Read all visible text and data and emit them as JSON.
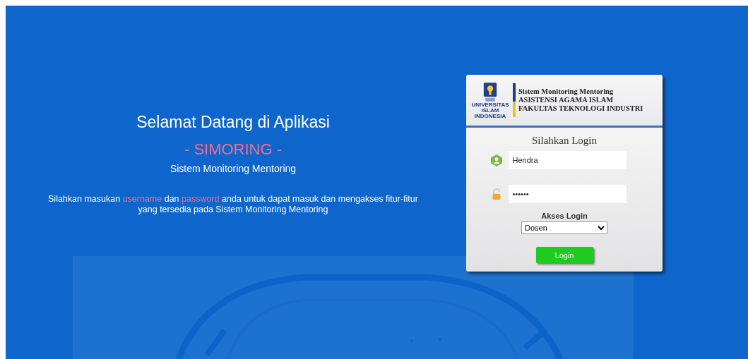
{
  "welcome": {
    "title": "Selamat Datang di Aplikasi",
    "app_name": "- SIMORING -",
    "subtitle": "Sistem Monitoring Mentoring",
    "message": [
      {
        "text": "Silahkan masukan ",
        "highlight": false
      },
      {
        "text": "username",
        "highlight": true
      },
      {
        "text": " dan ",
        "highlight": false
      },
      {
        "text": "password",
        "highlight": true
      },
      {
        "text": " anda untuk dapat masuk dan mengakses fitur-fitur yang tersedia pada Sistem Monitoring Mentoring",
        "highlight": false
      }
    ]
  },
  "login_card": {
    "logo_text": [
      "UNIVERSITAS",
      "ISLAM",
      "INDONESIA"
    ],
    "header_lines": [
      "Sistem Monitoring Mentoring",
      "ASISTENSI AGAMA ISLAM",
      "FAKULTAS TEKNOLOGI INDUSTRI"
    ],
    "title": "Silahkan Login",
    "username": {
      "value": "Hendra"
    },
    "password": {
      "value": "••••••"
    },
    "access_label": "Akses Login",
    "access_select": {
      "value": "Dosen"
    },
    "login_button": "Login"
  }
}
